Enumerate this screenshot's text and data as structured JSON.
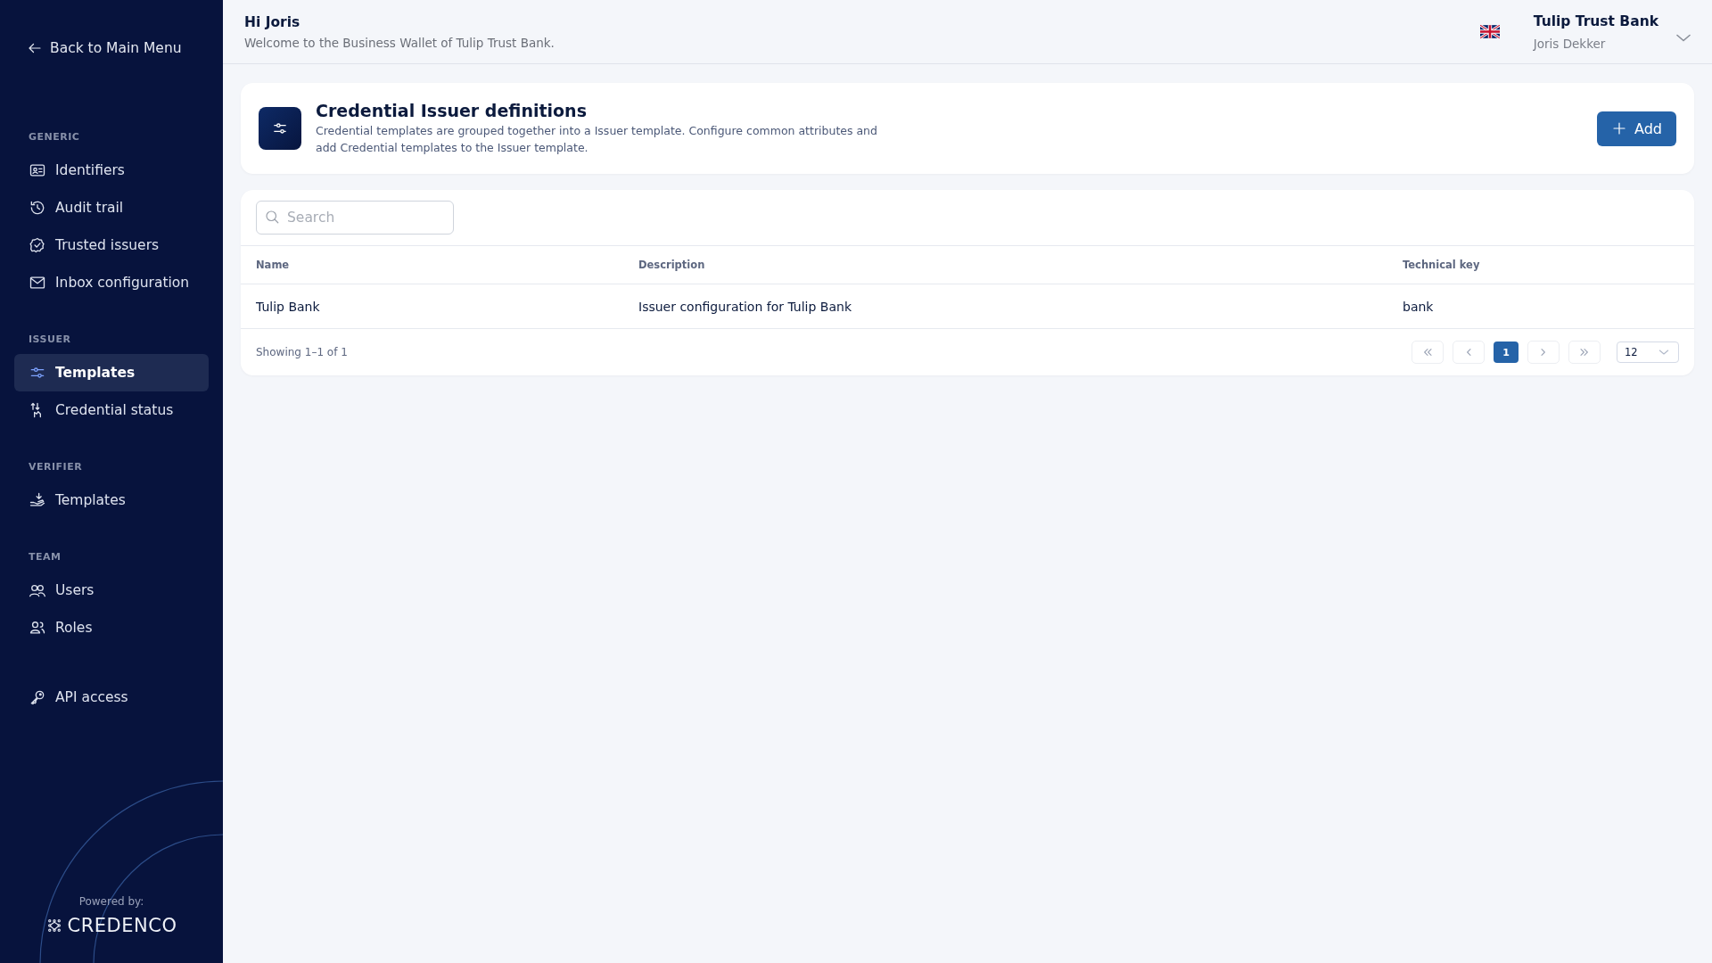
{
  "sidebar": {
    "back_link": "Back to Main Menu",
    "sections": [
      {
        "heading": "GENERIC",
        "items": [
          {
            "label": "Identifiers",
            "kind": "id",
            "selected": false
          },
          {
            "label": "Audit trail",
            "kind": "history",
            "selected": false
          },
          {
            "label": "Trusted issuers",
            "kind": "badge",
            "selected": false
          },
          {
            "label": "Inbox configuration",
            "kind": "mail",
            "selected": false
          }
        ]
      },
      {
        "heading": "ISSUER",
        "items": [
          {
            "label": "Templates",
            "kind": "sliders",
            "selected": true
          },
          {
            "label": "Credential status",
            "kind": "status",
            "selected": false
          }
        ]
      },
      {
        "heading": "VERIFIER",
        "items": [
          {
            "label": "Templates",
            "kind": "hand",
            "selected": false
          }
        ]
      },
      {
        "heading": "TEAM",
        "items": [
          {
            "label": "Users",
            "kind": "users",
            "selected": false
          },
          {
            "label": "Roles",
            "kind": "roles",
            "selected": false
          }
        ]
      },
      {
        "items": [
          {
            "label": "API access",
            "kind": "key",
            "selected": false
          }
        ]
      }
    ],
    "powered_by": "Powered by:",
    "brand": "CREDENCO"
  },
  "header": {
    "greeting": "Hi Joris",
    "welcome": "Welcome to the Business Wallet of Tulip Trust Bank.",
    "organization": "Tulip Trust Bank",
    "user": "Joris Dekker"
  },
  "page": {
    "title": "Credential Issuer definitions",
    "description": "Credential templates are grouped together into a Issuer template. Configure common attributes and add Credential templates to the Issuer template.",
    "add_button": "Add"
  },
  "table": {
    "search": {
      "placeholder": "Search"
    },
    "columns": [
      "Name",
      "Description",
      "Technical key"
    ],
    "rows": [
      [
        "Tulip Bank",
        "Issuer configuration for Tulip Bank",
        "bank"
      ]
    ],
    "showing": "Showing 1–1 of 1",
    "pages": [
      {
        "label": "1",
        "selected": true
      }
    ],
    "page_size": "12"
  }
}
